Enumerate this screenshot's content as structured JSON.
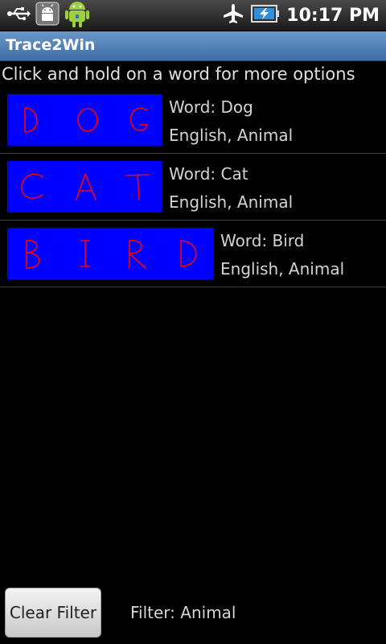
{
  "status_bar": {
    "time": "10:17 PM",
    "icons": [
      "usb-icon",
      "android-debug-icon",
      "android-mascot-icon",
      "airplane-mode-icon",
      "battery-charging-icon"
    ]
  },
  "app": {
    "title": "Trace2Win"
  },
  "instruction": "Click and hold on a word for more options",
  "words": [
    {
      "word_line": "Word: Dog",
      "category_line": "English, Animal",
      "trace_text": "DOG"
    },
    {
      "word_line": "Word: Cat",
      "category_line": "English, Animal",
      "trace_text": "CAT"
    },
    {
      "word_line": "Word: Bird",
      "category_line": "English, Animal",
      "trace_text": "BIRD"
    }
  ],
  "bottom": {
    "clear_filter_label": "Clear Filter",
    "filter_text": "Filter: Animal"
  },
  "colors": {
    "trace_background": "#0000ff",
    "trace_stroke": "#ff0000",
    "title_bar": "#4f82b8"
  }
}
